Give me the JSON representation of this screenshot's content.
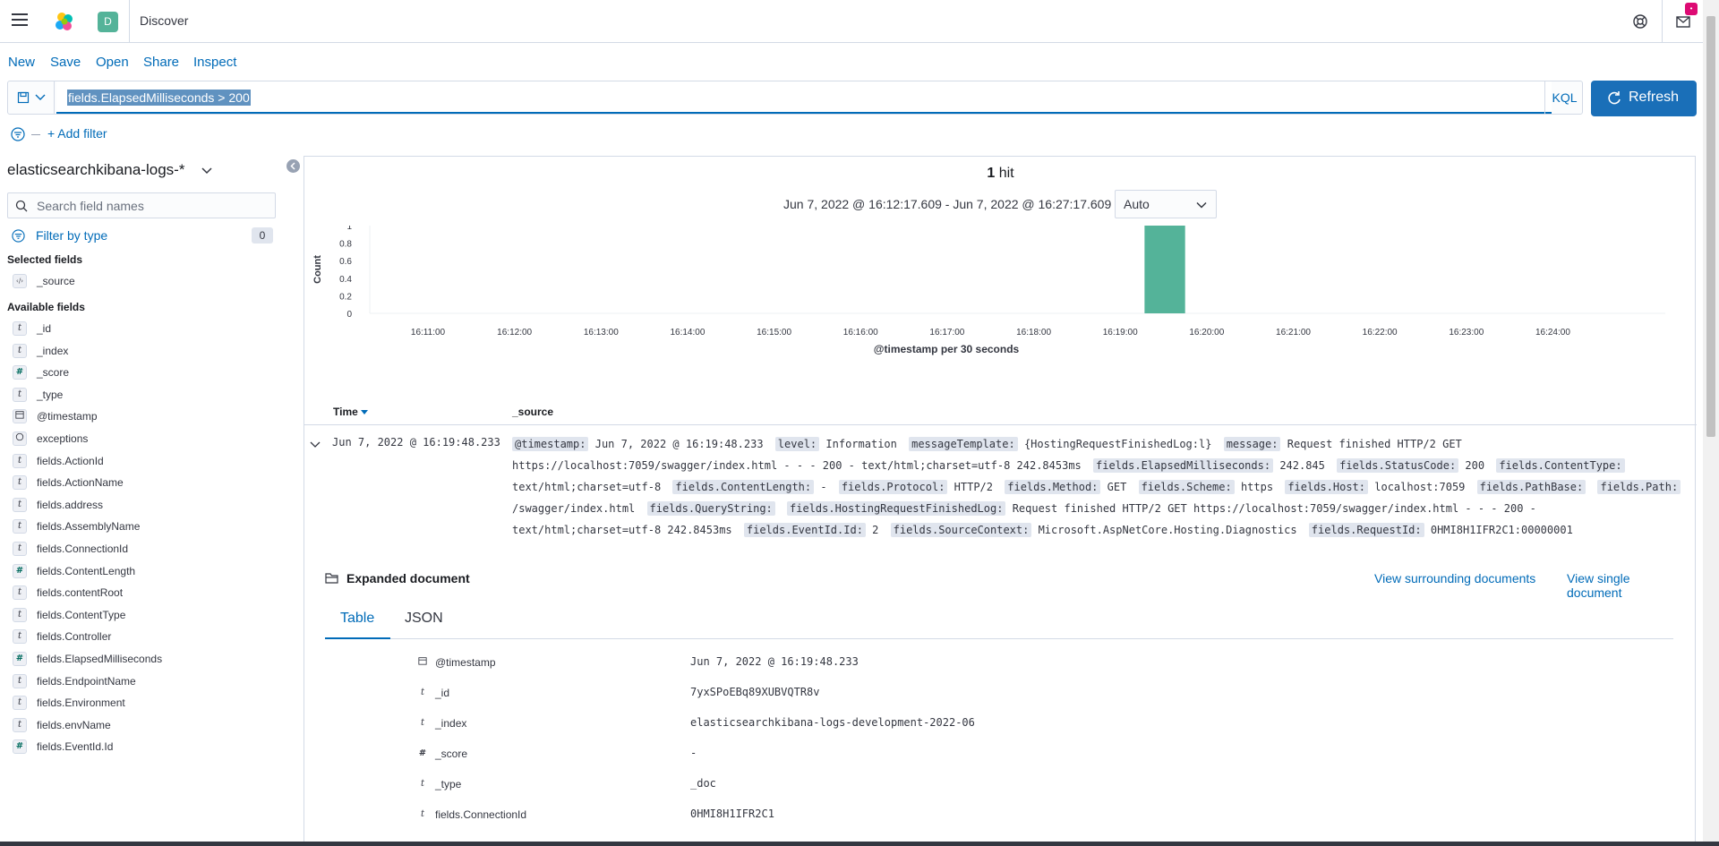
{
  "header": {
    "app_title": "Discover",
    "space_initial": "D",
    "notifications_badge": "•"
  },
  "topnav": {
    "new": "New",
    "save": "Save",
    "open": "Open",
    "share": "Share",
    "inspect": "Inspect"
  },
  "query": {
    "text": "fields.ElapsedMilliseconds > 200",
    "language": "KQL",
    "refresh_label": "Refresh",
    "add_filter": "+ Add filter"
  },
  "sidebar": {
    "index_pattern": "elasticsearchkibana-logs-*",
    "search_placeholder": "Search field names",
    "filter_by_type": "Filter by type",
    "filter_count": "0",
    "selected_heading": "Selected fields",
    "selected_fields": [
      {
        "name": "_source",
        "type": "source"
      }
    ],
    "available_heading": "Available fields",
    "available_fields": [
      {
        "name": "_id",
        "type": "t"
      },
      {
        "name": "_index",
        "type": "t"
      },
      {
        "name": "_score",
        "type": "#"
      },
      {
        "name": "_type",
        "type": "t"
      },
      {
        "name": "@timestamp",
        "type": "date"
      },
      {
        "name": "exceptions",
        "type": "obj"
      },
      {
        "name": "fields.ActionId",
        "type": "t"
      },
      {
        "name": "fields.ActionName",
        "type": "t"
      },
      {
        "name": "fields.address",
        "type": "t"
      },
      {
        "name": "fields.AssemblyName",
        "type": "t"
      },
      {
        "name": "fields.ConnectionId",
        "type": "t"
      },
      {
        "name": "fields.ContentLength",
        "type": "#"
      },
      {
        "name": "fields.contentRoot",
        "type": "t"
      },
      {
        "name": "fields.ContentType",
        "type": "t"
      },
      {
        "name": "fields.Controller",
        "type": "t"
      },
      {
        "name": "fields.ElapsedMilliseconds",
        "type": "#"
      },
      {
        "name": "fields.EndpointName",
        "type": "t"
      },
      {
        "name": "fields.Environment",
        "type": "t"
      },
      {
        "name": "fields.envName",
        "type": "t"
      },
      {
        "name": "fields.EventId.Id",
        "type": "#"
      }
    ]
  },
  "main": {
    "hits_count": "1",
    "hits_label": " hit",
    "time_range": "Jun 7, 2022 @ 16:12:17.609 - Jun 7, 2022 @ 16:27:17.609",
    "interval": "Auto",
    "col_time": "Time",
    "col_source": "_source",
    "row_time": "Jun 7, 2022 @ 16:19:48.233",
    "row_source": [
      {
        "k": "@timestamp:",
        "v": "Jun 7, 2022 @ 16:19:48.233"
      },
      {
        "k": "level:",
        "v": "Information"
      },
      {
        "k": "messageTemplate:",
        "v": "{HostingRequestFinishedLog:l}"
      },
      {
        "k": "message:",
        "v": "Request finished HTTP/2 GET https://localhost:7059/swagger/index.html - - - 200 - text/html;charset=utf-8 242.8453ms"
      },
      {
        "k": "fields.ElapsedMilliseconds:",
        "v": "242.845"
      },
      {
        "k": "fields.StatusCode:",
        "v": "200"
      },
      {
        "k": "fields.ContentType:",
        "v": "text/html;charset=utf-8"
      },
      {
        "k": "fields.ContentLength:",
        "v": " -"
      },
      {
        "k": "fields.Protocol:",
        "v": "HTTP/2"
      },
      {
        "k": "fields.Method:",
        "v": "GET"
      },
      {
        "k": "fields.Scheme:",
        "v": "https"
      },
      {
        "k": "fields.Host:",
        "v": "localhost:7059"
      },
      {
        "k": "fields.PathBase:",
        "v": ""
      },
      {
        "k": "fields.Path:",
        "v": "/swagger/index.html"
      },
      {
        "k": "fields.QueryString:",
        "v": ""
      },
      {
        "k": "fields.HostingRequestFinishedLog:",
        "v": "Request finished HTTP/2 GET https://localhost:7059/swagger/index.html - - - 200 - text/html;charset=utf-8 242.8453ms"
      },
      {
        "k": "fields.EventId.Id:",
        "v": "2"
      },
      {
        "k": "fields.SourceContext:",
        "v": "Microsoft.AspNetCore.Hosting.Diagnostics"
      },
      {
        "k": "fields.RequestId:",
        "v": "0HMI8H1IFR2C1:00000001"
      }
    ],
    "expanded_title": "Expanded document",
    "view_surrounding": "View surrounding documents",
    "view_single": "View single document",
    "tab_table": "Table",
    "tab_json": "JSON",
    "doc_fields": [
      {
        "type": "date",
        "name": "@timestamp",
        "value": "Jun 7, 2022 @ 16:19:48.233"
      },
      {
        "type": "t",
        "name": "_id",
        "value": "7yxSPoEBq89XUBVQTR8v"
      },
      {
        "type": "t",
        "name": "_index",
        "value": "elasticsearchkibana-logs-development-2022-06"
      },
      {
        "type": "#",
        "name": "_score",
        "value": " -"
      },
      {
        "type": "t",
        "name": "_type",
        "value": "_doc"
      },
      {
        "type": "t",
        "name": "fields.ConnectionId",
        "value": "0HMI8H1IFR2C1"
      }
    ]
  },
  "chart_data": {
    "type": "bar",
    "title": "",
    "xlabel": "@timestamp per 30 seconds",
    "ylabel": "Count",
    "x_ticks": [
      "16:11:00",
      "16:12:00",
      "16:13:00",
      "16:14:00",
      "16:15:00",
      "16:16:00",
      "16:17:00",
      "16:18:00",
      "16:19:00",
      "16:20:00",
      "16:21:00",
      "16:22:00",
      "16:23:00",
      "16:24:00"
    ],
    "y_ticks": [
      "0",
      "0.2",
      "0.4",
      "0.6",
      "0.8",
      "1"
    ],
    "ylim": [
      0,
      1
    ],
    "bars": [
      {
        "x": "16:19:30",
        "value": 1
      }
    ],
    "color": "#54b399"
  },
  "colors": {
    "accent": "#006bb8",
    "bar": "#54b399",
    "refresh_button": "#1a6fb8"
  }
}
